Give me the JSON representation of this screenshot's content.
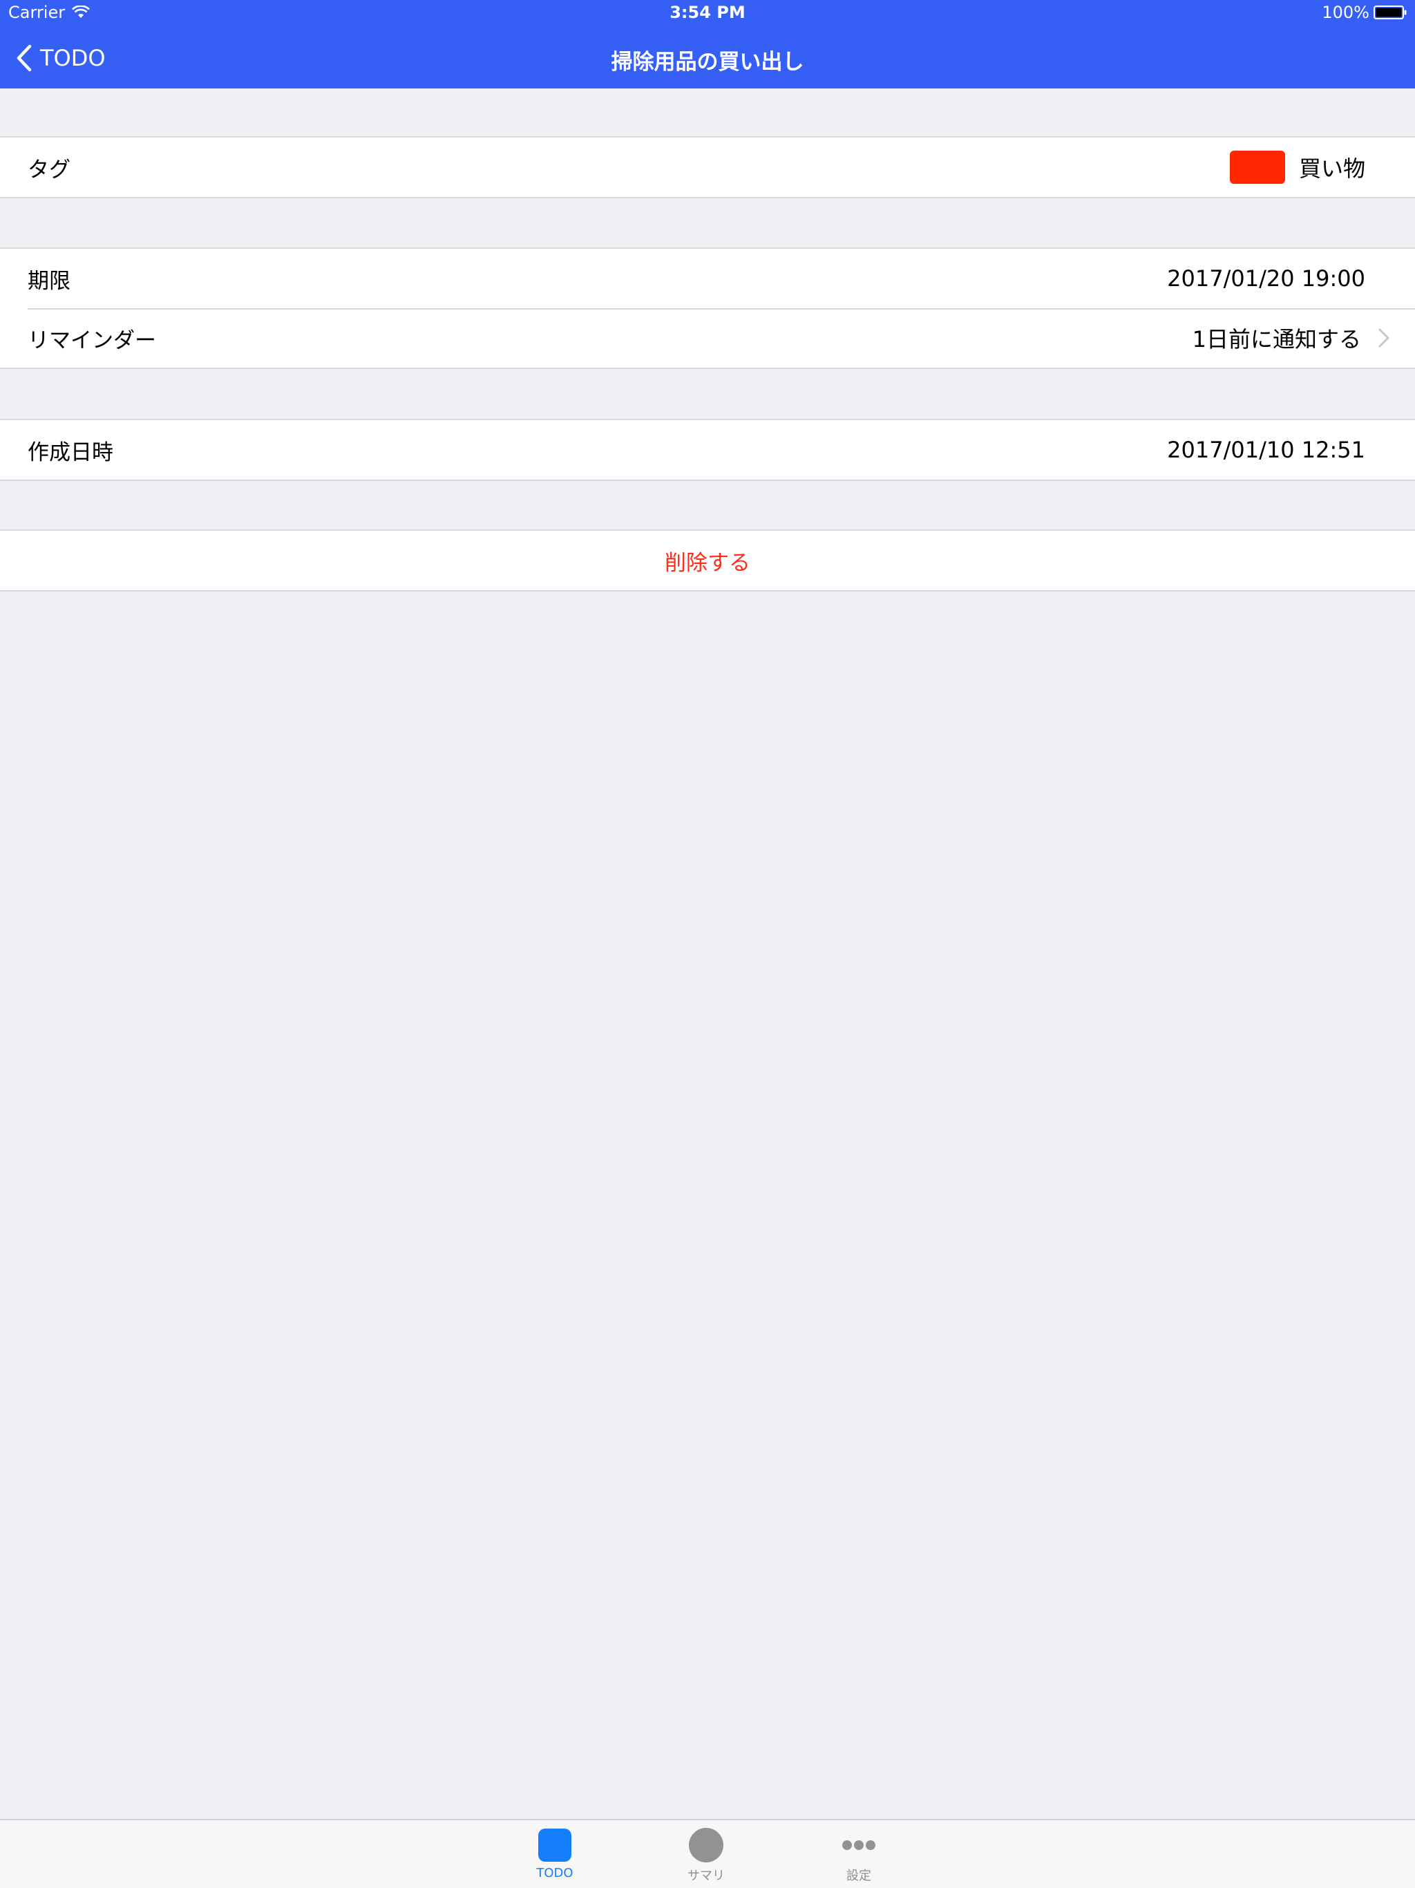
{
  "status_bar": {
    "carrier": "Carrier",
    "time": "3:54 PM",
    "battery": "100%"
  },
  "nav": {
    "back_label": "TODO",
    "title": "掃除用品の買い出し"
  },
  "colors": {
    "nav_background": "#355ff5",
    "tag_color": "#ff2600",
    "delete_text": "#ff2d16",
    "tab_active": "#157efb",
    "tab_inactive": "#8e8e93"
  },
  "sections": {
    "tag": {
      "label": "タグ",
      "value": "買い物"
    },
    "deadline": {
      "label": "期限",
      "value": "2017/01/20 19:00"
    },
    "reminder": {
      "label": "リマインダー",
      "value": "1日前に通知する"
    },
    "created": {
      "label": "作成日時",
      "value": "2017/01/10 12:51"
    },
    "delete": {
      "label": "削除する"
    }
  },
  "tab_bar": {
    "items": [
      {
        "label": "TODO",
        "icon": "rounded-square-icon",
        "active": true
      },
      {
        "label": "サマリ",
        "icon": "circle-icon",
        "active": false
      },
      {
        "label": "設定",
        "icon": "more-dots-icon",
        "active": false
      }
    ]
  }
}
